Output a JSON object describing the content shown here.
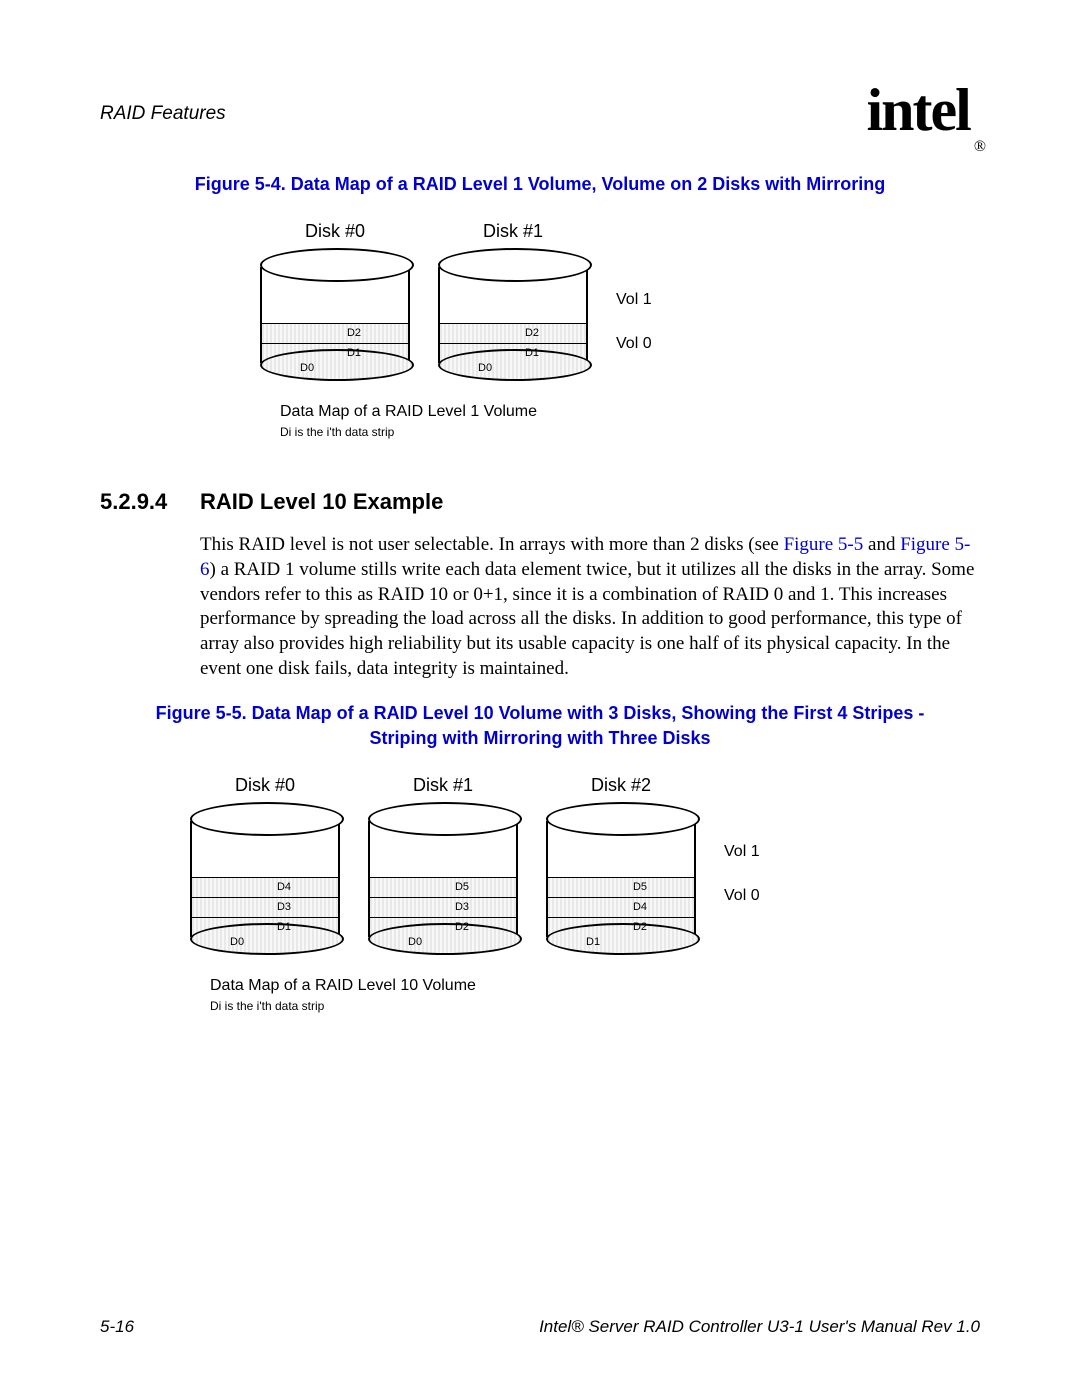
{
  "header": {
    "title": "RAID Features"
  },
  "logo": {
    "text": "intel",
    "reg": "®"
  },
  "fig1": {
    "caption": "Figure 5-4. Data Map of a RAID Level 1 Volume, Volume on 2 Disks with Mirroring",
    "disks": [
      {
        "label": "Disk #0",
        "strips": [
          "D2",
          "D1",
          "D0"
        ]
      },
      {
        "label": "Disk #1",
        "strips": [
          "D2",
          "D1",
          "D0"
        ]
      }
    ],
    "vol_labels": [
      "Vol 1",
      "Vol 0"
    ],
    "diag_caption": "Data Map of a RAID Level 1 Volume",
    "diag_note": "Di is the i'th data strip"
  },
  "section": {
    "num": "5.2.9.4",
    "title": "RAID Level 10 Example",
    "p1a": "This RAID level is not user selectable. In arrays with more than 2 disks (see ",
    "link1": "Figure 5-5",
    "p1b": " and ",
    "link2": "Figure 5-6",
    "p1c": ") a RAID 1 volume stills write each data element twice, but it utilizes all the disks in the array. Some vendors refer to this as RAID 10 or 0+1, since it is a combination of RAID 0 and 1. This increases performance by spreading the load across all the disks. In addition to good performance, this type of array also provides high reliability but its usable capacity is one half of its physical capacity. In the event one disk fails, data integrity is maintained."
  },
  "fig2": {
    "caption": "Figure 5-5. Data Map of a RAID Level 10 Volume with 3 Disks, Showing the First 4 Stripes - Striping with Mirroring with Three Disks",
    "disks": [
      {
        "label": "Disk #0",
        "strips": [
          "D4",
          "D3",
          "D1",
          "D0"
        ]
      },
      {
        "label": "Disk #1",
        "strips": [
          "D5",
          "D3",
          "D2",
          "D0"
        ]
      },
      {
        "label": "Disk #2",
        "strips": [
          "D5",
          "D4",
          "D2",
          "D1"
        ]
      }
    ],
    "vol_labels": [
      "Vol 1",
      "Vol 0"
    ],
    "diag_caption": "Data Map of a RAID Level 10 Volume",
    "diag_note": "Di is the i'th data strip"
  },
  "footer": {
    "left": "5-16",
    "right": "Intel® Server RAID Controller U3-1 User's Manual Rev 1.0"
  }
}
